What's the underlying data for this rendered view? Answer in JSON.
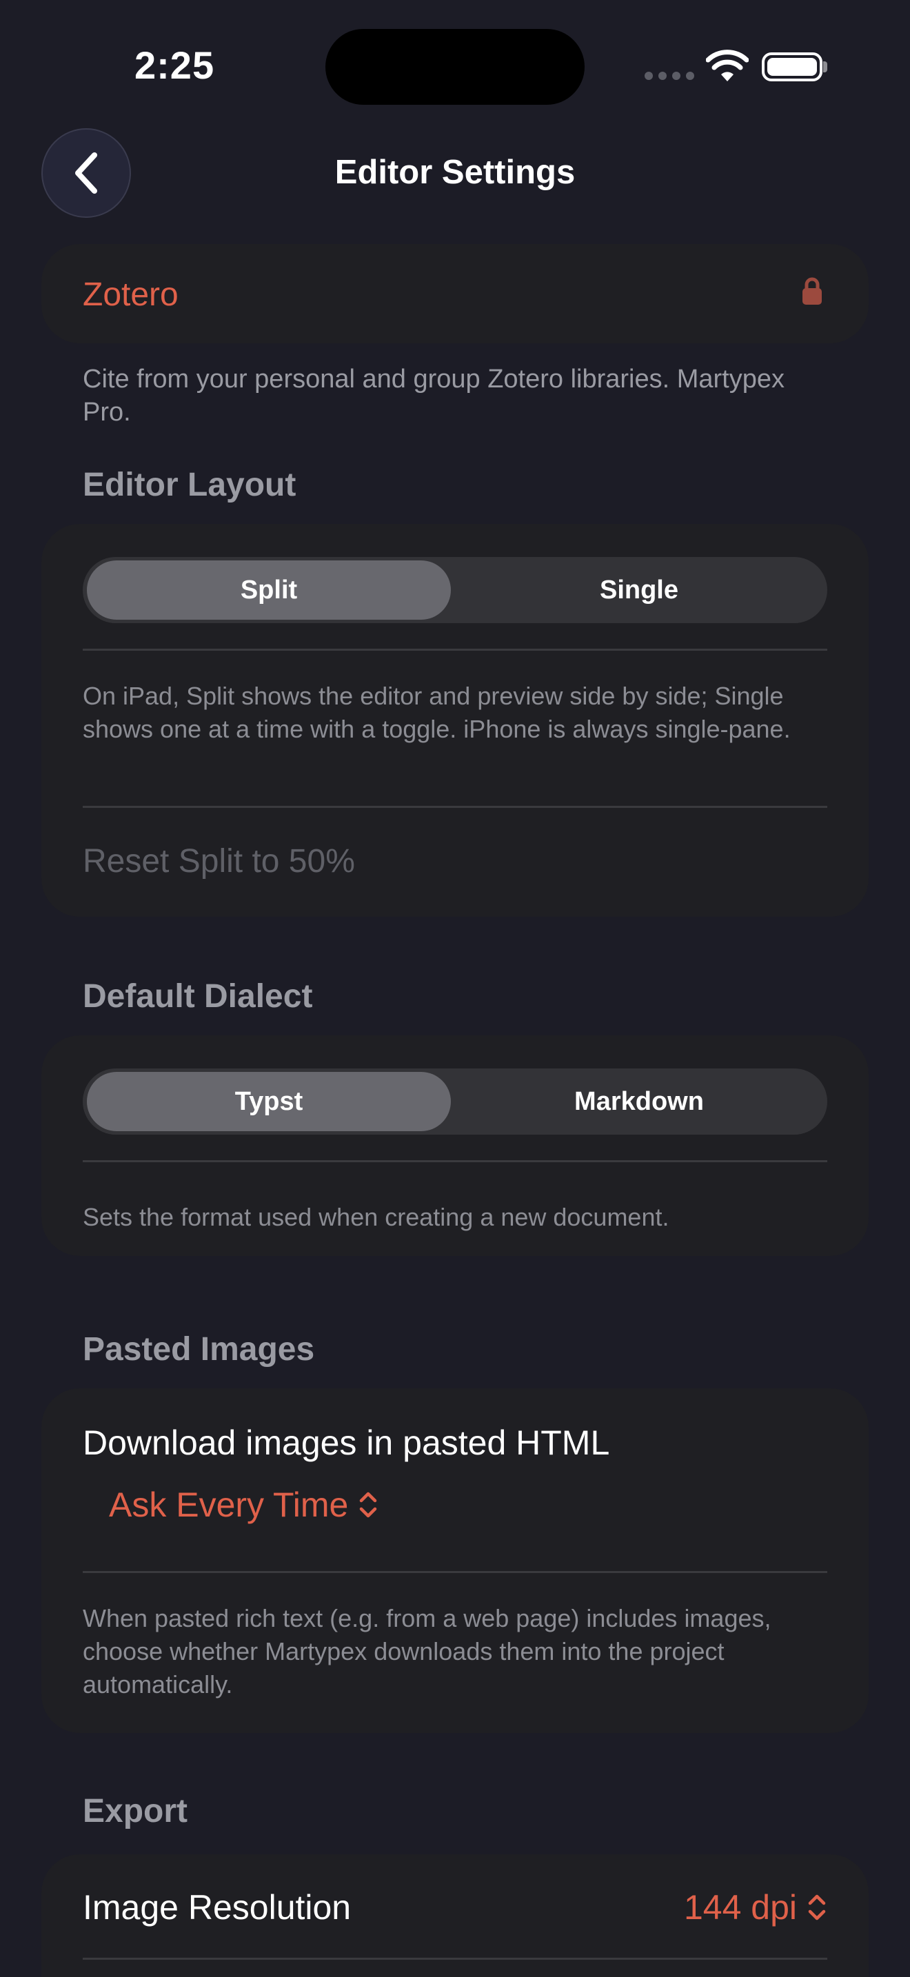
{
  "status_bar": {
    "time": "2:25"
  },
  "nav": {
    "title": "Editor Settings"
  },
  "zotero": {
    "label": "Zotero",
    "footnote": "Cite from your personal and group Zotero libraries. Martypex Pro."
  },
  "editor_layout": {
    "header": "Editor Layout",
    "segments": [
      "Split",
      "Single"
    ],
    "selected": "Split",
    "footnote": "On iPad, Split shows the editor and preview side by side; Single shows one at a time with a toggle. iPhone is always single-pane.",
    "reset_label": "Reset Split to 50%"
  },
  "default_dialect": {
    "header": "Default Dialect",
    "segments": [
      "Typst",
      "Markdown"
    ],
    "selected": "Typst",
    "footnote": "Sets the format used when creating a new document."
  },
  "pasted_images": {
    "header": "Pasted Images",
    "row_label": "Download images in pasted HTML",
    "value": "Ask Every Time",
    "footnote": "When pasted rich text (e.g. from a web page) includes images, choose whether Martypex downloads them into the project automatically."
  },
  "export": {
    "header": "Export",
    "row_label": "Image Resolution",
    "value": "144 dpi"
  },
  "colors": {
    "background": "#1c1c26",
    "card": "#1f1f23",
    "accent": "#e0614a",
    "secondary_text": "#8c8d94"
  }
}
